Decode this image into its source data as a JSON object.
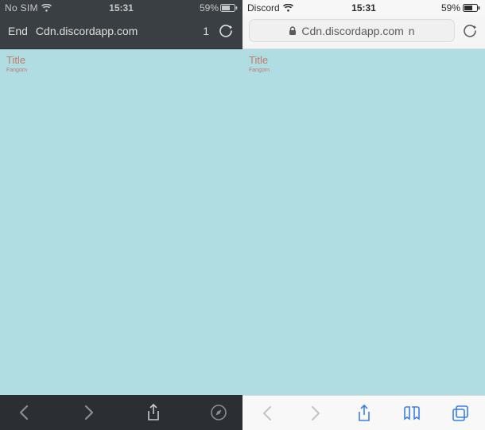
{
  "dark": {
    "status": {
      "carrier": "No SIM",
      "time": "15:31",
      "battery_text": "59%"
    },
    "address": {
      "prefix": "End",
      "url": "Cdn.discordapp.com",
      "tail": "1"
    },
    "page": {
      "title": "Title",
      "subtext": "Fangorn"
    }
  },
  "light": {
    "status": {
      "carrier": "Discord",
      "time": "15:31",
      "battery_text": "59%"
    },
    "address": {
      "url": "Cdn.discordapp.com",
      "tail": "n"
    },
    "page": {
      "title": "Title",
      "subtext": "Fangorn"
    }
  }
}
